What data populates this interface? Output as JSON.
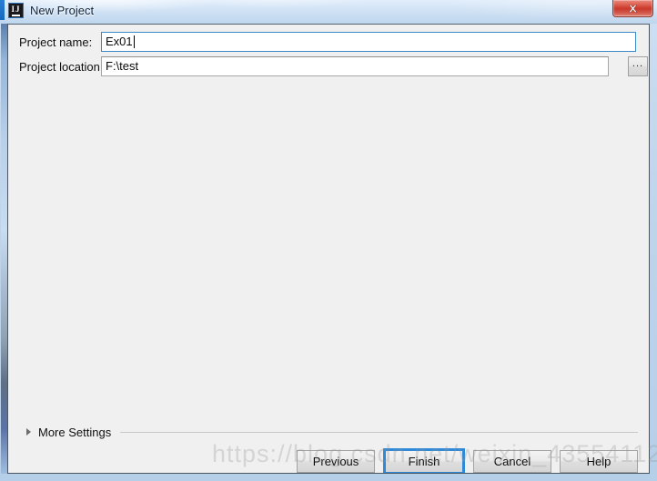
{
  "window": {
    "title": "New Project",
    "app_icon": "intellij-idea-icon",
    "icon_letters": "IJ",
    "close_label": "✕"
  },
  "form": {
    "project_name": {
      "label": "Project name:",
      "value": "Ex01",
      "placeholder": "",
      "focused": true
    },
    "project_location": {
      "label": "Project location:",
      "value": "F:\\test",
      "placeholder": "",
      "focused": false
    },
    "browse_button": {
      "label": "...",
      "icon": "ellipsis-icon"
    }
  },
  "more_settings": {
    "label": "More Settings",
    "expanded": false,
    "arrow_icon": "triangle-right-icon"
  },
  "buttons": {
    "previous": "Previous",
    "finish": "Finish",
    "cancel": "Cancel",
    "help": "Help",
    "default_button": "Finish"
  },
  "watermark": {
    "text": "https://blog.csdn.net/weixin_43554112"
  },
  "colors": {
    "accent": "#2e8ad8",
    "titlebar_top": "#e2eefb",
    "titlebar_bottom": "#bfd6ee",
    "client_bg": "#f0f0f0",
    "close_red": "#c9382b",
    "focus_border": "#3c87c8"
  }
}
